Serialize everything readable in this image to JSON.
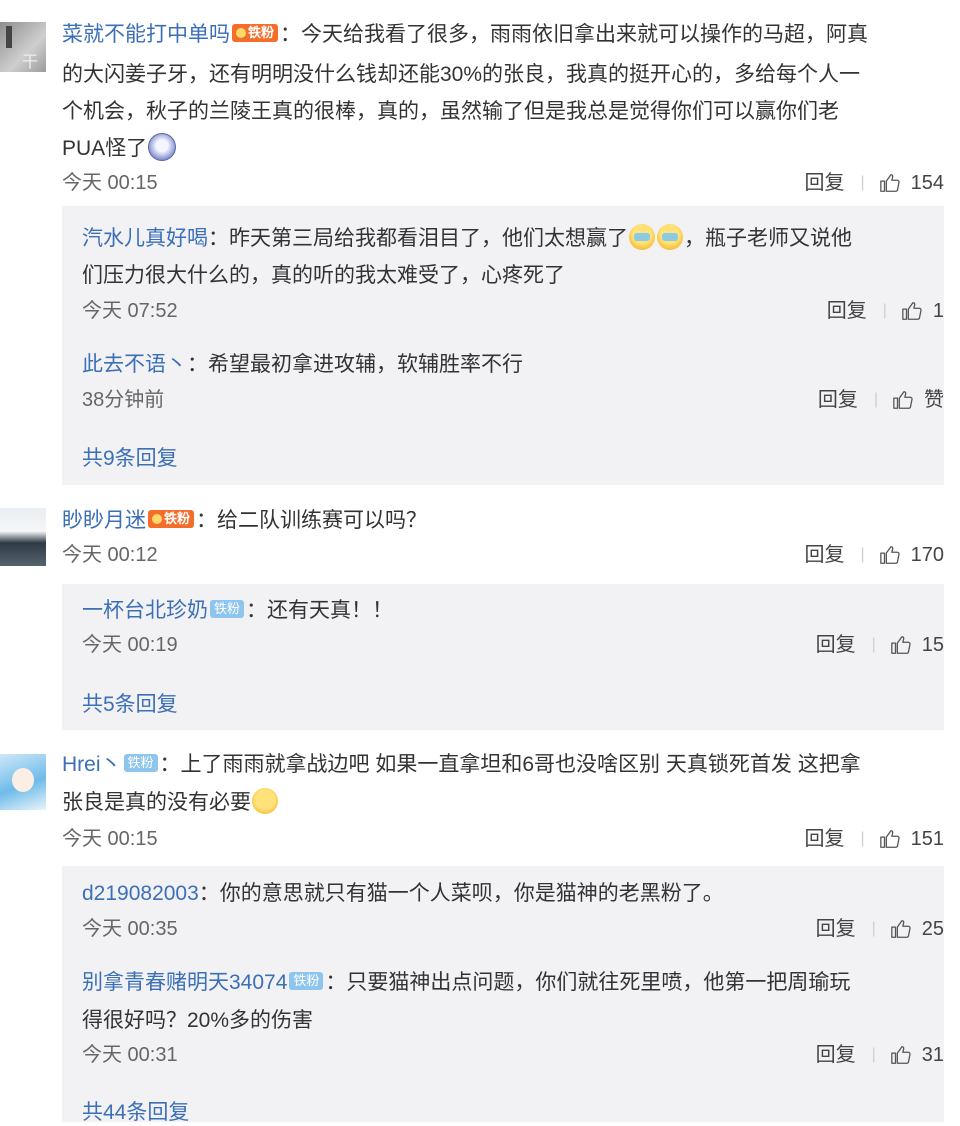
{
  "comments": [
    {
      "username": "菜就不能打中单吗",
      "badge": "铁粉",
      "lines": [
        "：今天给我看了很多，雨雨依旧拿出来就可以操作的马超，阿真",
        "的大闪姜子牙，还有明明没什么钱却还能30%的张良，我真的挺开心的，多给每个人一",
        "个机会，秋子的兰陵王真的很棒，真的，虽然输了但是我总是觉得你们可以赢你们老",
        "PUA怪了"
      ],
      "emoji": "shocked-face-emoji",
      "time": "今天 00:15",
      "reply_label": "回复",
      "likes": "154",
      "replies": [
        {
          "username": "汽水儿真好喝",
          "lines": [
            "：昨天第三局给我都看泪目了，他们太想赢了",
            "，瓶子老师又说他",
            "们压力很大什么的，真的听的我太难受了，心疼死了"
          ],
          "time": "今天 07:52",
          "reply_label": "回复",
          "likes": "1"
        },
        {
          "username": "此去不语丶",
          "lines": [
            "：希望最初拿进攻辅，软辅胜率不行"
          ],
          "time": "38分钟前",
          "reply_label": "回复",
          "likes": "赞"
        }
      ],
      "more_replies": "共9条回复"
    },
    {
      "username": "眇眇月迷",
      "badge": "铁粉",
      "lines": [
        "：给二队训练赛可以吗？"
      ],
      "time": "今天 00:12",
      "reply_label": "回复",
      "likes": "170",
      "replies": [
        {
          "username": "一杯台北珍奶",
          "badge": "铁粉",
          "lines": [
            "：还有天真！！"
          ],
          "time": "今天 00:19",
          "reply_label": "回复",
          "likes": "15"
        }
      ],
      "more_replies": "共5条回复"
    },
    {
      "username": "Hrei丶",
      "badge": "铁粉",
      "lines": [
        "：上了雨雨就拿战边吧 如果一直拿坦和6哥也没啥区别 天真锁死首发 这把拿",
        "张良是真的没有必要"
      ],
      "time": "今天 00:15",
      "reply_label": "回复",
      "likes": "151",
      "replies": [
        {
          "username": "d219082003",
          "lines": [
            "：你的意思就只有猫一个人菜呗，你是猫神的老黑粉了。"
          ],
          "time": "今天 00:35",
          "reply_label": "回复",
          "likes": "25"
        },
        {
          "username": "别拿青春赌明天34074",
          "badge": "铁粉",
          "lines": [
            "：只要猫神出点问题，你们就往死里喷，他第一把周瑜玩",
            "得很好吗？20%多的伤害"
          ],
          "time": "今天 00:31",
          "reply_label": "回复",
          "likes": "31"
        }
      ],
      "more_replies": "共44条回复"
    }
  ]
}
